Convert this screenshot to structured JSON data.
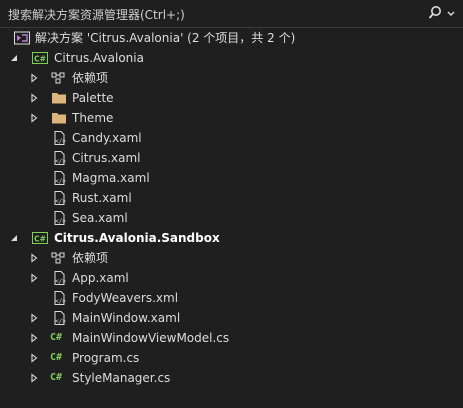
{
  "search": {
    "placeholder": "搜索解决方案资源管理器(Ctrl+;)"
  },
  "solution": {
    "label": "解决方案 'Citrus.Avalonia' (2 个项目，共 2 个)"
  },
  "project1": {
    "label": "Citrus.Avalonia",
    "items": [
      {
        "label": "依赖项",
        "kind": "dependencies"
      },
      {
        "label": "Palette",
        "kind": "folder"
      },
      {
        "label": "Theme",
        "kind": "folder"
      },
      {
        "label": "Candy.xaml",
        "kind": "xaml"
      },
      {
        "label": "Citrus.xaml",
        "kind": "xaml"
      },
      {
        "label": "Magma.xaml",
        "kind": "xaml"
      },
      {
        "label": "Rust.xaml",
        "kind": "xaml"
      },
      {
        "label": "Sea.xaml",
        "kind": "xaml"
      }
    ]
  },
  "project2": {
    "label": "Citrus.Avalonia.Sandbox",
    "items": [
      {
        "label": "依赖项",
        "kind": "dependencies"
      },
      {
        "label": "App.xaml",
        "kind": "xaml"
      },
      {
        "label": "FodyWeavers.xml",
        "kind": "xml"
      },
      {
        "label": "MainWindow.xaml",
        "kind": "xaml"
      },
      {
        "label": "MainWindowViewModel.cs",
        "kind": "cs"
      },
      {
        "label": "Program.cs",
        "kind": "cs"
      },
      {
        "label": "StyleManager.cs",
        "kind": "cs"
      }
    ]
  },
  "colors": {
    "background": "#1f1f1f",
    "folder": "#dcb67a",
    "cs_green": "#7ecf5a",
    "solution_purple": "#b180d7"
  }
}
